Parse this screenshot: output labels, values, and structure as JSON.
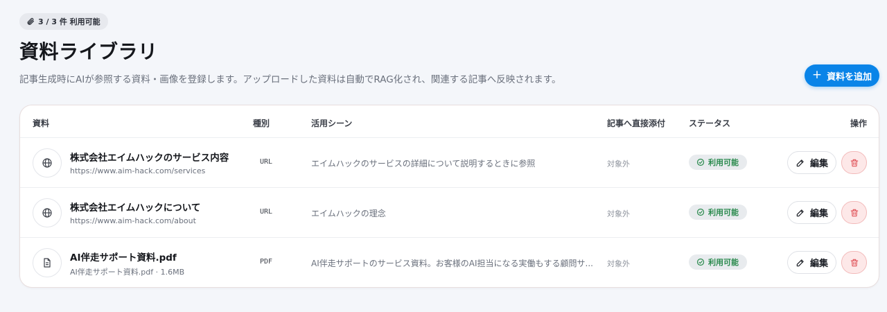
{
  "badge": {
    "icon": "paperclip-icon",
    "text": "3 / 3 件 利用可能"
  },
  "header": {
    "title": "資料ライブラリ",
    "description": "記事生成時にAIが参照する資料・画像を登録します。アップロードした資料は自動でRAG化され、関連する記事へ反映されます。"
  },
  "add_button": {
    "icon": "plus-icon",
    "label": "資料を追加"
  },
  "table": {
    "columns": {
      "resource": "資料",
      "type": "種別",
      "scene": "活用シーン",
      "attach": "記事へ直接添付",
      "status": "ステータス",
      "actions": "操作"
    },
    "rows": [
      {
        "icon": "globe-icon",
        "name": "株式会社エイムハックのサービス内容",
        "sub": "https://www.aim-hack.com/services",
        "type": "URL",
        "scene": "エイムハックのサービスの詳細について説明するときに参照",
        "attach": "対象外",
        "status": "利用可能",
        "edit_label": "編集"
      },
      {
        "icon": "globe-icon",
        "name": "株式会社エイムハックについて",
        "sub": "https://www.aim-hack.com/about",
        "type": "URL",
        "scene": "エイムハックの理念",
        "attach": "対象外",
        "status": "利用可能",
        "edit_label": "編集"
      },
      {
        "icon": "document-icon",
        "name": "AI伴走サポート資料.pdf",
        "sub": "AI伴走サポート資料.pdf · 1.6MB",
        "type": "PDF",
        "scene": "AI伴走サポートのサービス資料。お客様のAI担当になる実働もする顧問サ...",
        "attach": "対象外",
        "status": "利用可能",
        "edit_label": "編集"
      }
    ]
  },
  "colors": {
    "accent": "#0a84e8",
    "status_text": "#2a8a4d",
    "delete_bg": "#fde8e8",
    "delete_icon": "#e0545a"
  }
}
